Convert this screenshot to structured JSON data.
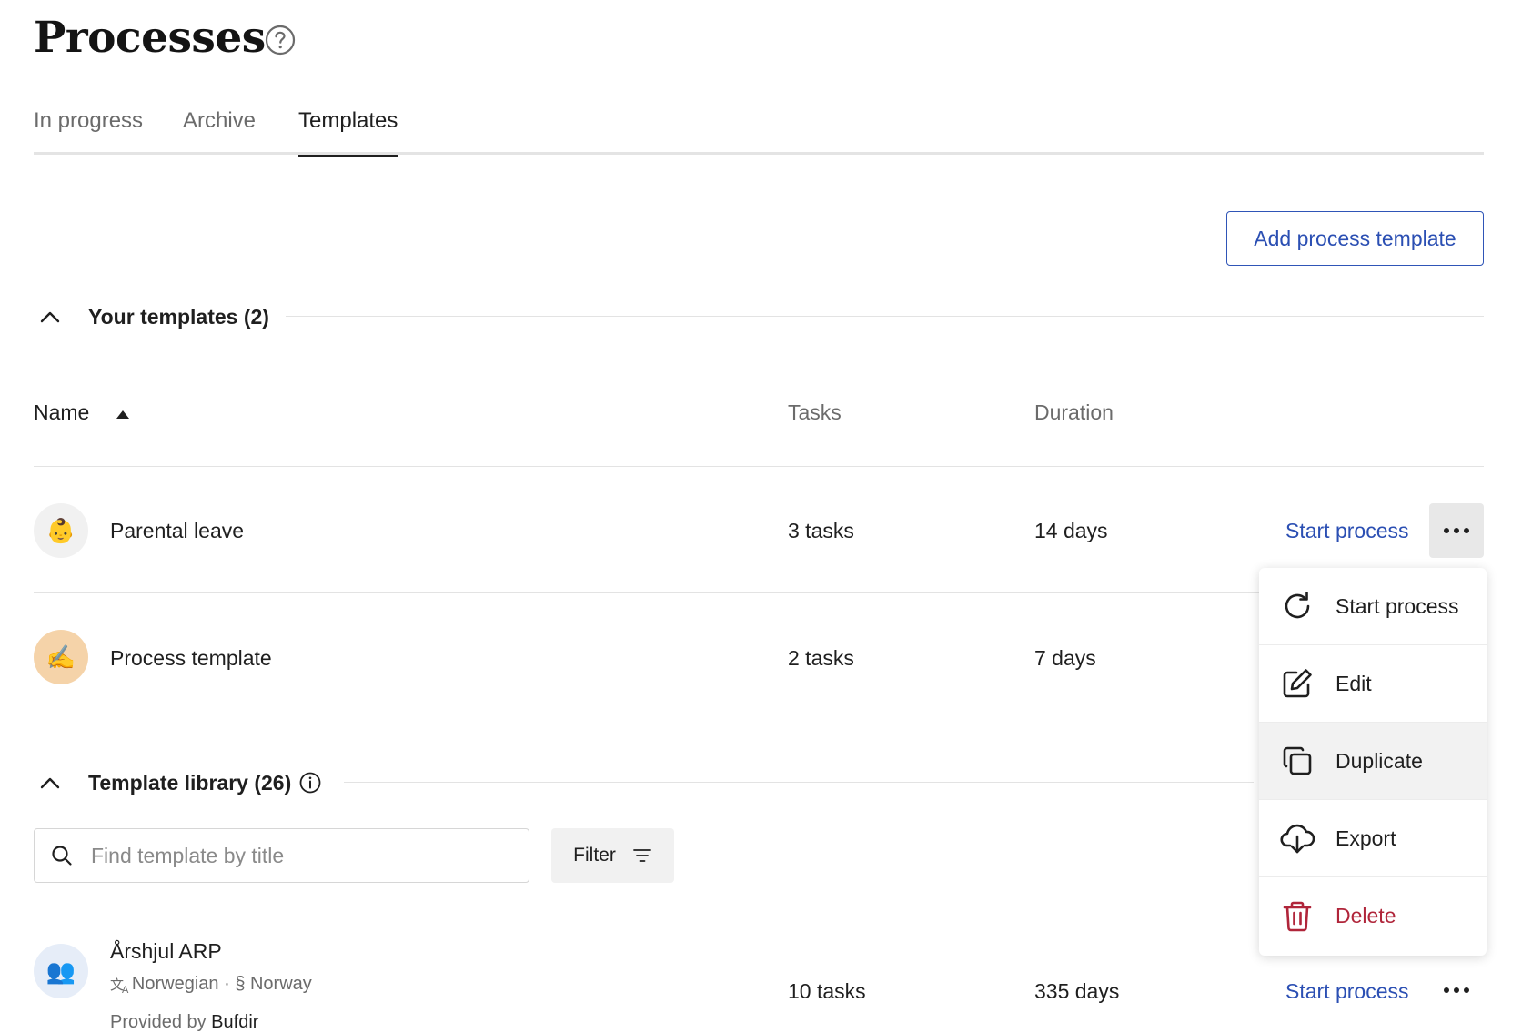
{
  "page": {
    "title": "Processes"
  },
  "tabs": [
    {
      "label": "In progress",
      "active": false
    },
    {
      "label": "Archive",
      "active": false
    },
    {
      "label": "Templates",
      "active": true
    }
  ],
  "actions": {
    "add_template": "Add process template"
  },
  "your_templates": {
    "title": "Your templates (2)",
    "columns": {
      "name": "Name",
      "tasks": "Tasks",
      "duration": "Duration"
    },
    "rows": [
      {
        "emoji": "👶",
        "name": "Parental leave",
        "tasks": "3 tasks",
        "duration": "14 days",
        "action": "Start process"
      },
      {
        "emoji": "✍️",
        "name": "Process template",
        "tasks": "2 tasks",
        "duration": "7 days"
      }
    ]
  },
  "library": {
    "title": "Template library (26)",
    "search_placeholder": "Find template by title",
    "filter_label": "Filter",
    "rows": [
      {
        "emoji": "👥",
        "name": "Årshjul ARP",
        "language": "Norwegian",
        "sep": " · ",
        "law": "§ Norway",
        "provided_prefix": "Provided by ",
        "provider": "Bufdir",
        "tasks": "10 tasks",
        "duration": "335 days",
        "action": "Start process"
      }
    ]
  },
  "context_menu": {
    "items": [
      {
        "label": "Start process",
        "icon": "refresh-icon"
      },
      {
        "label": "Edit",
        "icon": "edit-icon"
      },
      {
        "label": "Duplicate",
        "icon": "duplicate-icon"
      },
      {
        "label": "Export",
        "icon": "cloud-download-icon"
      },
      {
        "label": "Delete",
        "icon": "trash-icon"
      }
    ]
  },
  "colors": {
    "accent": "#2b4fb3",
    "danger": "#b0253a",
    "avatar_warm": "#f5d3a9",
    "avatar_blue": "#e6edf8"
  }
}
